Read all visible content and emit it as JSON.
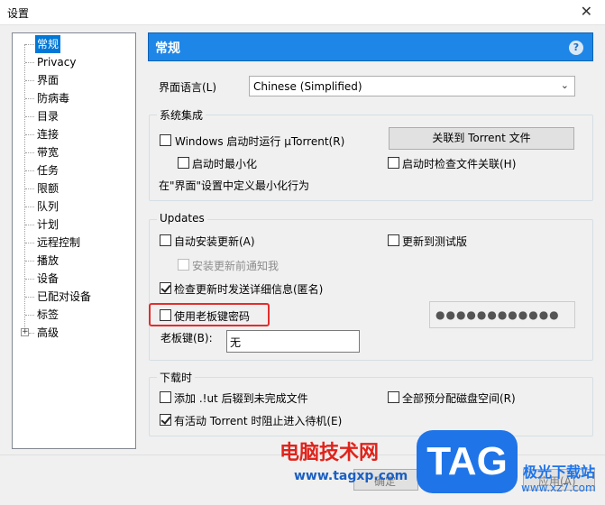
{
  "window": {
    "title": "设置"
  },
  "tree": {
    "items": [
      {
        "label": "常规",
        "selected": true
      },
      {
        "label": "Privacy"
      },
      {
        "label": "界面"
      },
      {
        "label": "防病毒"
      },
      {
        "label": "目录"
      },
      {
        "label": "连接"
      },
      {
        "label": "带宽"
      },
      {
        "label": "任务"
      },
      {
        "label": "限额"
      },
      {
        "label": "队列"
      },
      {
        "label": "计划"
      },
      {
        "label": "远程控制"
      },
      {
        "label": "播放"
      },
      {
        "label": "设备"
      },
      {
        "label": "已配对设备"
      },
      {
        "label": "标签"
      },
      {
        "label": "高级",
        "expandable": true
      }
    ]
  },
  "header": {
    "title": "常规",
    "help": "?"
  },
  "language": {
    "label": "界面语言(L)",
    "value": "Chinese (Simplified)"
  },
  "system": {
    "title": "系统集成",
    "run_on_startup": {
      "label": "Windows 启动时运行 µTorrent(R)",
      "checked": false
    },
    "associate_button": "关联到 Torrent 文件",
    "start_minimized": {
      "label": "启动时最小化",
      "checked": false
    },
    "check_assoc": {
      "label": "启动时检查文件关联(H)",
      "checked": false
    },
    "hint": "在\"界面\"设置中定义最小化行为"
  },
  "updates": {
    "title": "Updates",
    "auto_install": {
      "label": "自动安装更新(A)",
      "checked": false
    },
    "beta": {
      "label": "更新到测试版",
      "checked": false
    },
    "notify": {
      "label": "安装更新前通知我",
      "checked": false
    },
    "send_info": {
      "label": "检查更新时发送详细信息(匿名)",
      "checked": true
    }
  },
  "boss_key": {
    "use_password": {
      "label": "使用老板键密码",
      "checked": false
    },
    "password_mask": "●●●●●●●●●●●●",
    "key_label": "老板键(B):",
    "key_value": "无"
  },
  "download": {
    "title": "下载时",
    "append_ut": {
      "label": "添加 .!ut 后辍到未完成文件",
      "checked": false
    },
    "prealloc": {
      "label": "全部预分配磁盘空间(R)",
      "checked": false
    },
    "prevent_standby": {
      "label": "有活动 Torrent 时阻止进入待机(E)",
      "checked": true
    }
  },
  "buttons": {
    "ok": "确定",
    "cancel": "应用(A)"
  },
  "watermark": {
    "cn": "电脑技术网",
    "url": "www.tagxp.com",
    "tag": "TAG",
    "site": "极光下载站",
    "site_url": "www.xz7.com"
  }
}
